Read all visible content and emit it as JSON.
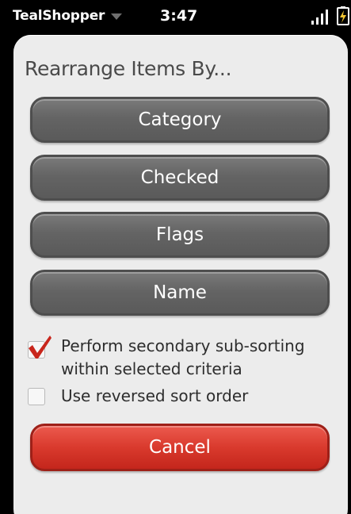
{
  "status_bar": {
    "app_name": "TealShopper",
    "time": "3:47"
  },
  "dialog": {
    "title": "Rearrange Items By...",
    "sort_buttons": [
      {
        "label": "Category"
      },
      {
        "label": "Checked"
      },
      {
        "label": "Flags"
      },
      {
        "label": "Name"
      }
    ],
    "options": [
      {
        "label": "Perform secondary sub-sorting within selected criteria",
        "checked": true
      },
      {
        "label": "Use reversed sort order",
        "checked": false
      }
    ],
    "cancel_label": "Cancel"
  },
  "colors": {
    "button_gray": "#646464",
    "cancel_red": "#d93a2d",
    "check_red": "#c8261c",
    "dialog_bg": "#ececec"
  },
  "icons": [
    "caret-down-icon",
    "signal-icon",
    "battery-charging-icon",
    "checkmark-icon"
  ]
}
